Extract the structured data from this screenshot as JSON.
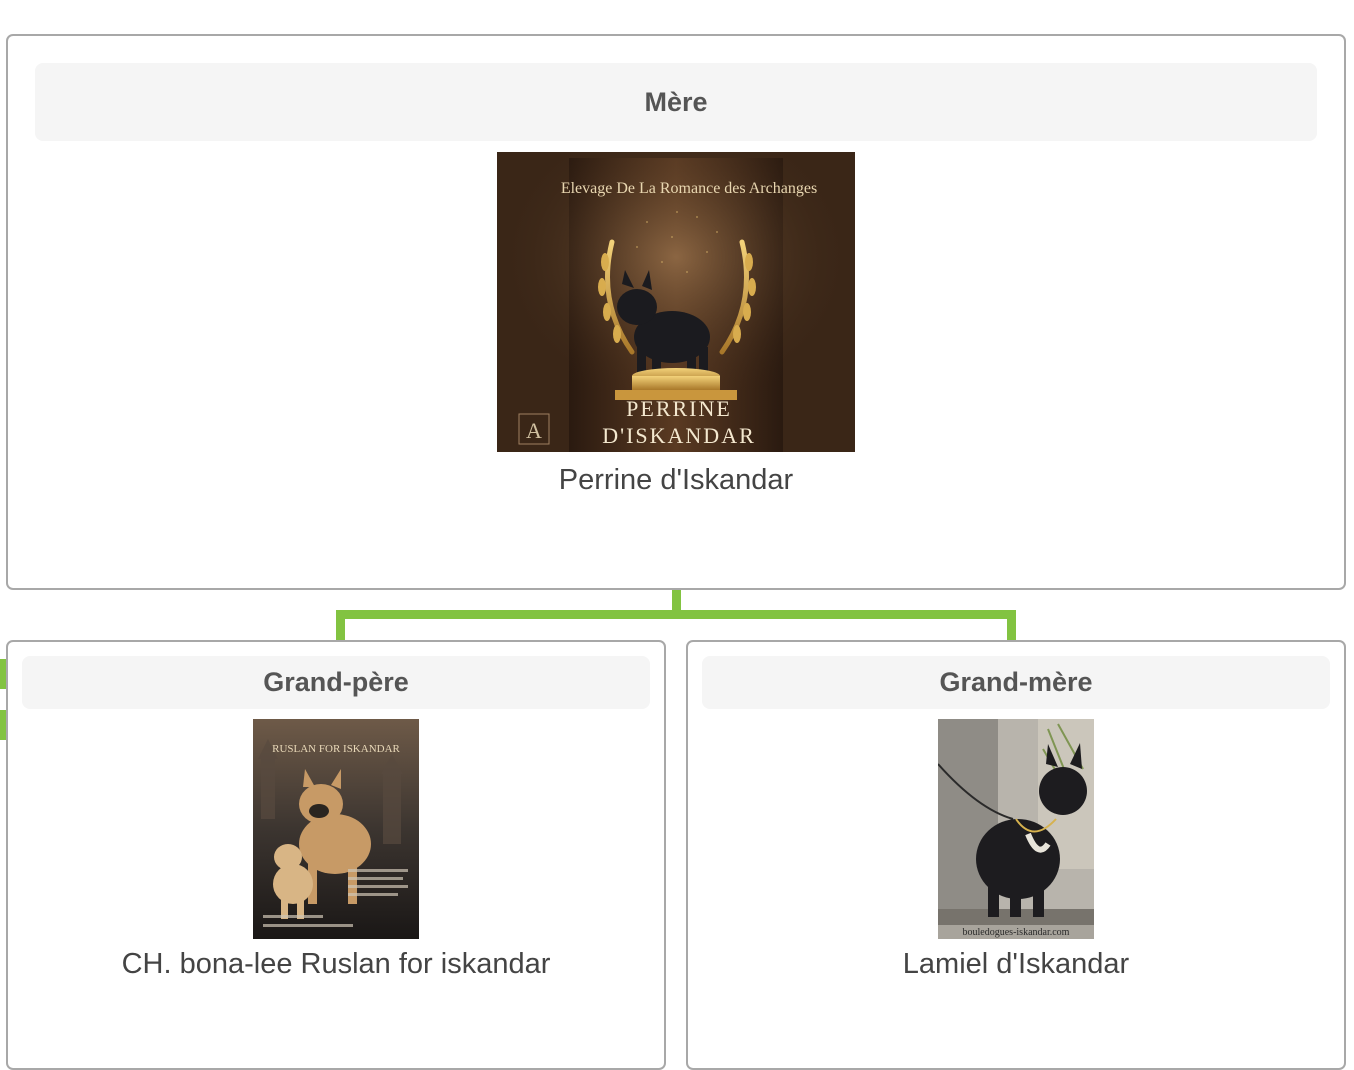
{
  "mother": {
    "header": "Mère",
    "name": "Perrine d'Iskandar",
    "photo": {
      "icon": "french-bulldog-trophy-poster",
      "banner": "Elevage De La Romance des Archanges",
      "plaque_line1": "PERRINE",
      "plaque_line2": "D'ISKANDAR",
      "monogram": "A"
    }
  },
  "grandfather": {
    "header": "Grand-père",
    "name": "CH. bona-lee Ruslan for iskandar",
    "photo": {
      "icon": "fawn-french-bulldog-poster",
      "caption": "RUSLAN FOR ISKANDAR"
    }
  },
  "grandmother": {
    "header": "Grand-mère",
    "name": "Lamiel d'Iskandar",
    "photo": {
      "icon": "black-french-bulldog-photo",
      "watermark": "bouledogues-iskandar.com"
    }
  },
  "colors": {
    "connector": "#82c341",
    "border": "#a8a8a8",
    "header_bg": "#f5f5f5",
    "text": "#555555"
  }
}
